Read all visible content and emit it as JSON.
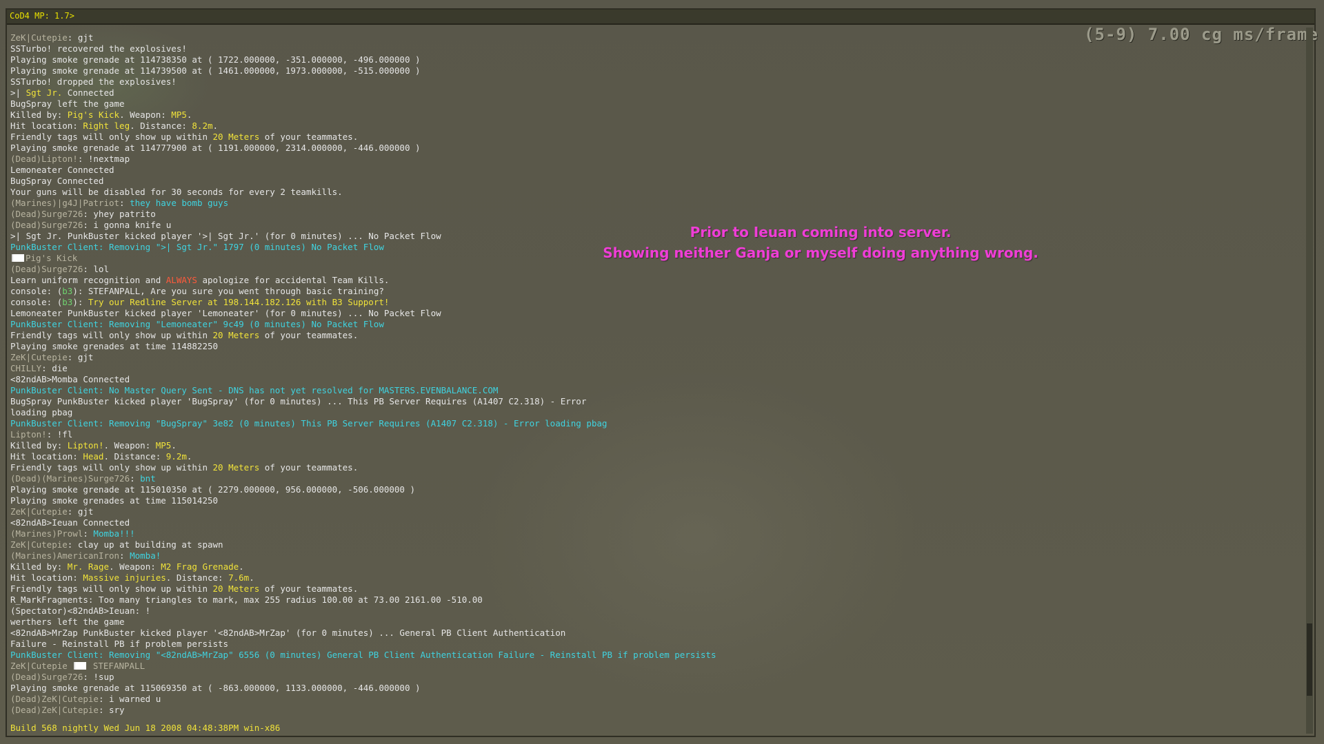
{
  "window": {
    "title": "CoD4 MP: 1.7>",
    "fps_readout": "(5-9) 7.00 cg ms/frame",
    "build": "Build 568 nightly Wed Jun 18 2008 04:48:38PM win-x86"
  },
  "annotation": {
    "line1": "Prior to Ieuan coming into server.",
    "line2": "Showing neither Ganja or myself doing anything wrong."
  },
  "console_lines": [
    [
      {
        "c": "dim",
        "t": "ZeK|Cutepie"
      },
      {
        "t": ": gjt"
      }
    ],
    [
      {
        "t": "SSTurbo! recovered the explosives!"
      }
    ],
    [
      {
        "t": "Playing smoke grenade at 114738350 at ( 1722.000000, -351.000000, -496.000000 )"
      }
    ],
    [
      {
        "t": "Playing smoke grenade at 114739500 at ( 1461.000000, 1973.000000, -515.000000 )"
      }
    ],
    [
      {
        "t": "SSTurbo! dropped the explosives!"
      }
    ],
    [
      {
        "t": ">| "
      },
      {
        "c": "y",
        "t": "Sgt Jr."
      },
      {
        "t": " Connected"
      }
    ],
    [
      {
        "t": "BugSpray left the game"
      }
    ],
    [
      {
        "t": "Killed by: "
      },
      {
        "c": "y",
        "t": "Pig's Kick"
      },
      {
        "t": ". Weapon: "
      },
      {
        "c": "y",
        "t": "MP5"
      },
      {
        "t": "."
      }
    ],
    [
      {
        "t": "Hit location: "
      },
      {
        "c": "y",
        "t": "Right leg"
      },
      {
        "t": ". Distance: "
      },
      {
        "c": "y",
        "t": "8.2m"
      },
      {
        "t": "."
      }
    ],
    [
      {
        "t": "Friendly tags will only show up within "
      },
      {
        "c": "y",
        "t": "20 Meters"
      },
      {
        "t": " of your teammates."
      }
    ],
    [
      {
        "t": "Playing smoke grenade at 114777900 at ( 1191.000000, 2314.000000, -446.000000 )"
      }
    ],
    [
      {
        "c": "dim",
        "t": "(Dead)Lipton!"
      },
      {
        "t": ": !nextmap"
      }
    ],
    [
      {
        "t": "Lemoneater Connected"
      }
    ],
    [
      {
        "t": "BugSpray Connected"
      }
    ],
    [
      {
        "t": "Your guns will be disabled for 30 seconds for every 2 teamkills."
      }
    ],
    [
      {
        "c": "dim",
        "t": "(Marines)|g4J|Patriot"
      },
      {
        "t": ": "
      },
      {
        "c": "c",
        "t": "they have bomb guys"
      }
    ],
    [
      {
        "c": "dim",
        "t": "(Dead)Surge726"
      },
      {
        "t": ": yhey patrito"
      }
    ],
    [
      {
        "c": "dim",
        "t": "(Dead)Surge726"
      },
      {
        "t": ": i gonna knife u"
      }
    ],
    [
      {
        "t": ">| Sgt Jr. PunkBuster kicked player '>| Sgt Jr.' (for 0 minutes) ... No Packet Flow"
      }
    ],
    [
      {
        "c": "c",
        "t": "PunkBuster Client: Removing \">| Sgt Jr.\" 1797 (0 minutes) No Packet Flow"
      }
    ],
    [
      {
        "flag": true
      },
      {
        "c": "dim",
        "t": "Pig's Kick"
      }
    ],
    [
      {
        "c": "dim",
        "t": "(Dead)Surge726"
      },
      {
        "t": ": lol"
      }
    ],
    [
      {
        "t": "Learn uniform recognition and "
      },
      {
        "c": "r",
        "t": "ALWAYS"
      },
      {
        "t": " apologize for accidental Team Kills."
      }
    ],
    [
      {
        "t": "console: ("
      },
      {
        "c": "g",
        "t": "b3"
      },
      {
        "t": "): STEFANPALL, Are you sure you went through basic training?"
      }
    ],
    [
      {
        "t": "console: ("
      },
      {
        "c": "g",
        "t": "b3"
      },
      {
        "t": "): "
      },
      {
        "c": "y",
        "t": "Try our Redline Server at 198.144.182.126 with B3 Support!"
      }
    ],
    [
      {
        "t": "Lemoneater PunkBuster kicked player 'Lemoneater' (for 0 minutes) ... No Packet Flow"
      }
    ],
    [
      {
        "c": "c",
        "t": "PunkBuster Client: Removing \"Lemoneater\" 9c49 (0 minutes) No Packet Flow"
      }
    ],
    [
      {
        "t": "Friendly tags will only show up within "
      },
      {
        "c": "y",
        "t": "20 Meters"
      },
      {
        "t": " of your teammates."
      }
    ],
    [
      {
        "t": "Playing smoke grenades at time 114882250"
      }
    ],
    [
      {
        "c": "dim",
        "t": "ZeK|Cutepie"
      },
      {
        "t": ": gjt"
      }
    ],
    [
      {
        "c": "dim",
        "t": "CHILLY"
      },
      {
        "t": ": die"
      }
    ],
    [
      {
        "t": "<82ndAB>Momba Connected"
      }
    ],
    [
      {
        "c": "c",
        "t": "PunkBuster Client: No Master Query Sent - DNS has not yet resolved for MASTERS.EVENBALANCE.COM"
      }
    ],
    [
      {
        "t": "BugSpray PunkBuster kicked player 'BugSpray' (for 0 minutes) ... This PB Server Requires (A1407 C2.318) - Error"
      }
    ],
    [
      {
        "t": "loading pbag"
      }
    ],
    [
      {
        "c": "c",
        "t": "PunkBuster Client: Removing \"BugSpray\" 3e82 (0 minutes) This PB Server Requires (A1407 C2.318) - Error loading pbag"
      }
    ],
    [
      {
        "c": "dim",
        "t": "Lipton!"
      },
      {
        "t": ": !fl"
      }
    ],
    [
      {
        "t": "Killed by: "
      },
      {
        "c": "y",
        "t": "Lipton!"
      },
      {
        "t": ". Weapon: "
      },
      {
        "c": "y",
        "t": "MP5"
      },
      {
        "t": "."
      }
    ],
    [
      {
        "t": "Hit location: "
      },
      {
        "c": "y",
        "t": "Head"
      },
      {
        "t": ". Distance: "
      },
      {
        "c": "y",
        "t": "9.2m"
      },
      {
        "t": "."
      }
    ],
    [
      {
        "t": "Friendly tags will only show up within "
      },
      {
        "c": "y",
        "t": "20 Meters"
      },
      {
        "t": " of your teammates."
      }
    ],
    [
      {
        "c": "dim",
        "t": "(Dead)(Marines)Surge726"
      },
      {
        "t": ": "
      },
      {
        "c": "c",
        "t": "bnt"
      }
    ],
    [
      {
        "t": "Playing smoke grenade at 115010350 at ( 2279.000000, 956.000000, -506.000000 )"
      }
    ],
    [
      {
        "t": "Playing smoke grenades at time 115014250"
      }
    ],
    [
      {
        "c": "dim",
        "t": "ZeK|Cutepie"
      },
      {
        "t": ": gjt"
      }
    ],
    [
      {
        "t": "<82ndAB>Ieuan Connected"
      }
    ],
    [
      {
        "c": "dim",
        "t": "(Marines)Prowl"
      },
      {
        "t": ": "
      },
      {
        "c": "c",
        "t": "Momba!!!"
      }
    ],
    [
      {
        "c": "dim",
        "t": "ZeK|Cutepie"
      },
      {
        "t": ": clay up at building at spawn"
      }
    ],
    [
      {
        "c": "dim",
        "t": "(Marines)AmericanIron"
      },
      {
        "t": ": "
      },
      {
        "c": "c",
        "t": "Momba!"
      }
    ],
    [
      {
        "t": "Killed by: "
      },
      {
        "c": "y",
        "t": "Mr. Rage"
      },
      {
        "t": ". Weapon: "
      },
      {
        "c": "y",
        "t": "M2 Frag Grenade"
      },
      {
        "t": "."
      }
    ],
    [
      {
        "t": "Hit location: "
      },
      {
        "c": "y",
        "t": "Massive injuries"
      },
      {
        "t": ". Distance: "
      },
      {
        "c": "y",
        "t": "7.6m"
      },
      {
        "t": "."
      }
    ],
    [
      {
        "t": "Friendly tags will only show up within "
      },
      {
        "c": "y",
        "t": "20 Meters"
      },
      {
        "t": " of your teammates."
      }
    ],
    [
      {
        "t": "R_MarkFragments: Too many triangles to mark, max 255 radius 100.00 at 73.00 2161.00 -510.00"
      }
    ],
    [
      {
        "t": "(Spectator)<82ndAB>Ieuan: !"
      }
    ],
    [
      {
        "t": "werthers left the game"
      }
    ],
    [
      {
        "t": "<82ndAB>MrZap PunkBuster kicked player '<82ndAB>MrZap' (for 0 minutes) ... General PB Client Authentication"
      }
    ],
    [
      {
        "t": "Failure - Reinstall PB if problem persists"
      }
    ],
    [
      {
        "c": "c",
        "t": "PunkBuster Client: Removing \"<82ndAB>MrZap\" 6556 (0 minutes) General PB Client Authentication Failure - Reinstall PB if problem persists"
      }
    ],
    [
      {
        "c": "dim",
        "t": "ZeK|Cutepie "
      },
      {
        "flag": true
      },
      {
        "c": "dim",
        "t": " STEFANPALL"
      }
    ],
    [
      {
        "c": "dim",
        "t": "(Dead)Surge726"
      },
      {
        "t": ": !sup"
      }
    ],
    [
      {
        "t": "Playing smoke grenade at 115069350 at ( -863.000000, 1133.000000, -446.000000 )"
      }
    ],
    [
      {
        "c": "dim",
        "t": "(Dead)ZeK|Cutepie"
      },
      {
        "t": ": i warned u"
      }
    ],
    [
      {
        "c": "dim",
        "t": "(Dead)ZeK|Cutepie"
      },
      {
        "t": ": sry"
      }
    ]
  ]
}
